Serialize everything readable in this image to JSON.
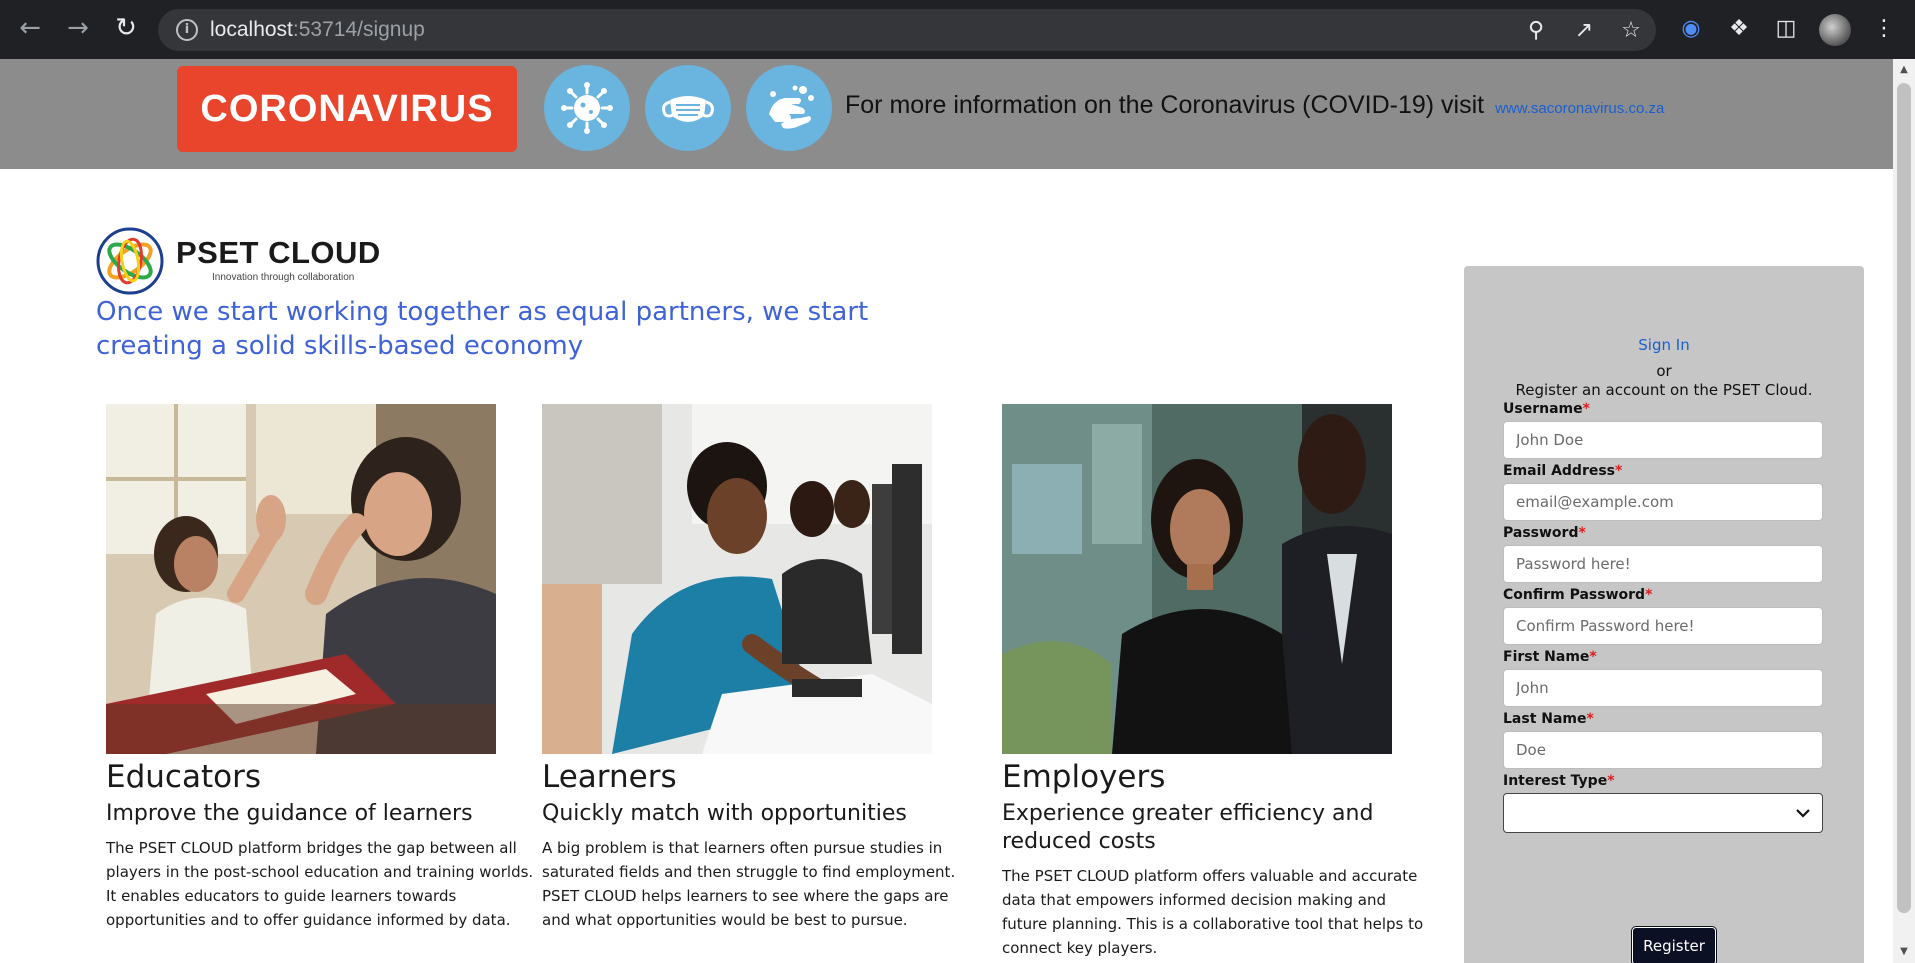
{
  "browser": {
    "url_host": "localhost",
    "url_rest": ":53714/signup"
  },
  "banner": {
    "button_label": "CORONAVIRUS",
    "info_text": "For more information on the Coronavirus (COVID-19) visit",
    "link_text": "www.sacoronavirus.co.za",
    "icons": [
      "virus-icon",
      "mask-icon",
      "handwash-icon"
    ]
  },
  "brand": {
    "name": "PSET CLOUD",
    "slogan": "Innovation through collaboration"
  },
  "tagline": "Once we start working together as equal partners, we start creating a solid skills-based economy",
  "columns": [
    {
      "title": "Educators",
      "subtitle": "Improve the guidance of learners",
      "text": "The PSET CLOUD platform bridges the gap between all players in the post-school education and training worlds. It enables educators to guide learners towards opportunities and to offer guidance informed by data."
    },
    {
      "title": "Learners",
      "subtitle": "Quickly match with opportunities",
      "text": "A big problem is that learners often pursue studies in saturated fields and then struggle to find employment. PSET CLOUD helps learners to see where the gaps are and what opportunities would be best to pursue."
    },
    {
      "title": "Employers",
      "subtitle": "Experience greater efficiency and reduced costs",
      "text": "The PSET CLOUD platform offers valuable and accurate data that empowers informed decision making and future planning. This is a collaborative tool that helps to connect key players."
    }
  ],
  "form": {
    "signin_label": "Sign In",
    "or_label": "or",
    "register_prompt": "Register an account on the PSET Cloud.",
    "required_mark": "*",
    "fields": [
      {
        "label": "Username",
        "placeholder": "John Doe"
      },
      {
        "label": "Email Address",
        "placeholder": "email@example.com"
      },
      {
        "label": "Password",
        "placeholder": "Password here!"
      },
      {
        "label": "Confirm Password",
        "placeholder": "Confirm Password here!"
      },
      {
        "label": "First Name",
        "placeholder": "John"
      },
      {
        "label": "Last Name",
        "placeholder": "Doe"
      }
    ],
    "interest_label": "Interest Type",
    "interest_value": "",
    "register_label": "Register"
  },
  "colors": {
    "banner_bg": "#8c8c8c",
    "coronavirus_red": "#e8452c",
    "icon_blue": "#6ab4e0",
    "tagline_blue": "#3f63d6",
    "panel_bg": "#c6c6c6",
    "register_btn": "#0b1024"
  }
}
